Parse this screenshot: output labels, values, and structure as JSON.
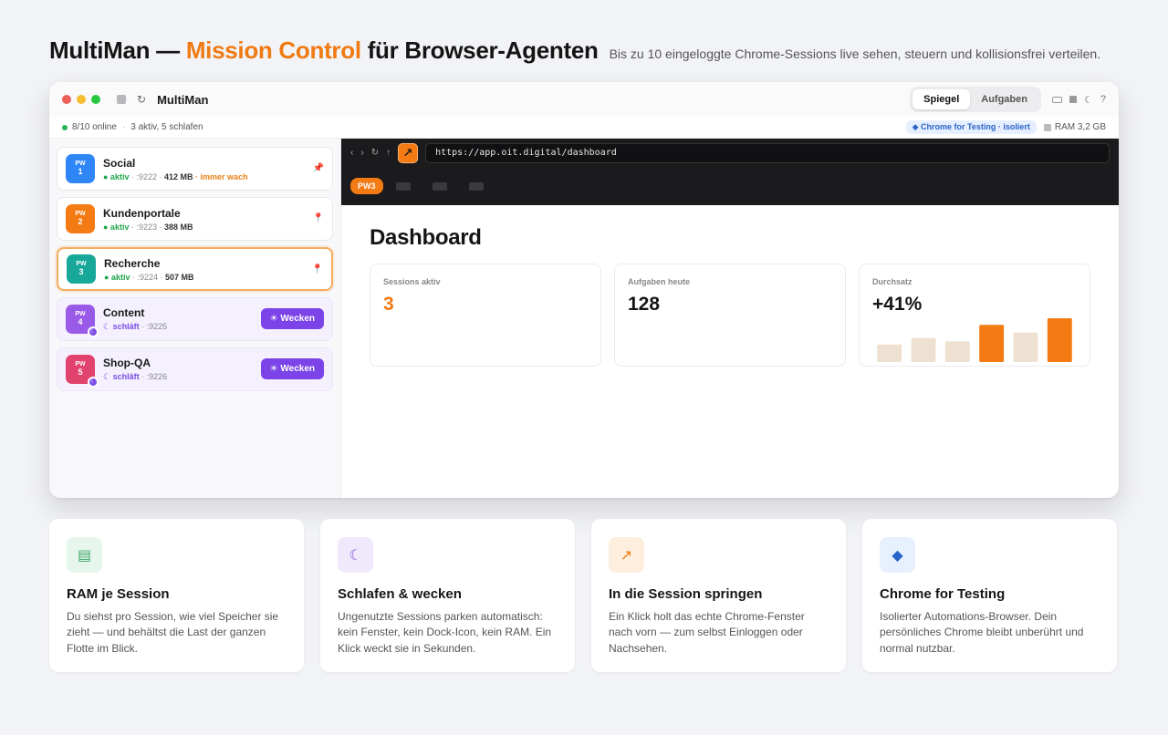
{
  "headline": {
    "prefix": "MultiMan —",
    "accent": "Mission Control",
    "suffix": "für Browser-Agenten",
    "subtitle": "Bis zu 10 eingeloggte Chrome-Sessions live sehen, steuern und kollisionsfrei verteilen.",
    "accent_color": "#f07a12"
  },
  "window": {
    "title": "MultiMan",
    "tabs": [
      "Spiegel",
      "Aufgaben"
    ],
    "active_tab": "Spiegel",
    "icons": {
      "theme": "☾",
      "help": "?"
    },
    "status": {
      "online": "8/10 online",
      "detail": "3 aktiv, 5 schlafen",
      "badge": "◆ Chrome for Testing · isoliert",
      "ram": "RAM 3,2 GB"
    }
  },
  "sessions": [
    {
      "pw": "PW",
      "num": "1",
      "name": "Social",
      "state": "● aktiv",
      "port": "· :9222 ·",
      "mem": "412 MB",
      "extra": "· immer wach",
      "color": "#2f86f6",
      "kind": "active",
      "pin": "📌"
    },
    {
      "pw": "PW",
      "num": "2",
      "name": "Kundenportale",
      "state": "● aktiv",
      "port": "· :9223 ·",
      "mem": "388 MB",
      "color": "#f47a13",
      "kind": "active",
      "pin": "📍"
    },
    {
      "pw": "PW",
      "num": "3",
      "name": "Recherche",
      "state": "● aktiv",
      "port": "· :9224 ·",
      "mem": "507 MB",
      "color": "#18a89a",
      "kind": "selected",
      "pin": "📍"
    },
    {
      "pw": "PW",
      "num": "4",
      "name": "Content",
      "state": "☾ schläft",
      "port": "· :9225",
      "color": "#9a5ae8",
      "kind": "sleep",
      "button": "☀ Wecken"
    },
    {
      "pw": "PW",
      "num": "5",
      "name": "Shop-QA",
      "state": "☾ schläft",
      "port": "· :9226",
      "color": "#e2436e",
      "kind": "sleep",
      "button": "☀ Wecken"
    }
  ],
  "browser": {
    "nav": [
      "‹",
      "›",
      "↻",
      "↑"
    ],
    "jump_icon": "↗",
    "url": "https://app.oit.digital/dashboard",
    "tab_label": "PW3"
  },
  "dashboard": {
    "title": "Dashboard",
    "cards": [
      {
        "label": "Sessions aktiv",
        "value": "3"
      },
      {
        "label": "Aufgaben heute",
        "value": "128"
      },
      {
        "label": "Durchsatz",
        "value": "+41%"
      }
    ]
  },
  "chart_data": {
    "type": "bar",
    "categories": [
      "",
      "",
      "",
      "",
      "",
      ""
    ],
    "values": [
      16,
      22,
      19,
      34,
      27,
      40
    ],
    "ylim": [
      0,
      40
    ],
    "colors": [
      "#efe1d2",
      "#efe1d2",
      "#efe1d2",
      "#f47a13",
      "#efe1d2",
      "#f47a13"
    ],
    "grid": false
  },
  "features": [
    {
      "icon": "▤",
      "icon_bg": "#e6f6ec",
      "icon_color": "#3aa566",
      "title": "RAM je Session",
      "text": "Du siehst pro Session, wie viel Speicher sie zieht — und behältst die Last der ganzen Flotte im Blick."
    },
    {
      "icon": "☾",
      "icon_bg": "#efe9fb",
      "icon_color": "#8a5ae0",
      "title": "Schlafen & wecken",
      "text": "Ungenutzte Sessions parken automatisch: kein Fenster, kein Dock-Icon, kein RAM. Ein Klick weckt sie in Sekunden."
    },
    {
      "icon": "↗",
      "icon_bg": "#fdeedd",
      "icon_color": "#f07a12",
      "title": "In die Session springen",
      "text": "Ein Klick holt das echte Chrome-Fenster nach vorn — zum selbst Einloggen oder Nachsehen."
    },
    {
      "icon": "◆",
      "icon_bg": "#e7f0fd",
      "icon_color": "#2b64c8",
      "title": "Chrome for Testing",
      "text": "Isolierter Automations-Browser. Dein persönliches Chrome bleibt unberührt und normal nutzbar."
    }
  ]
}
